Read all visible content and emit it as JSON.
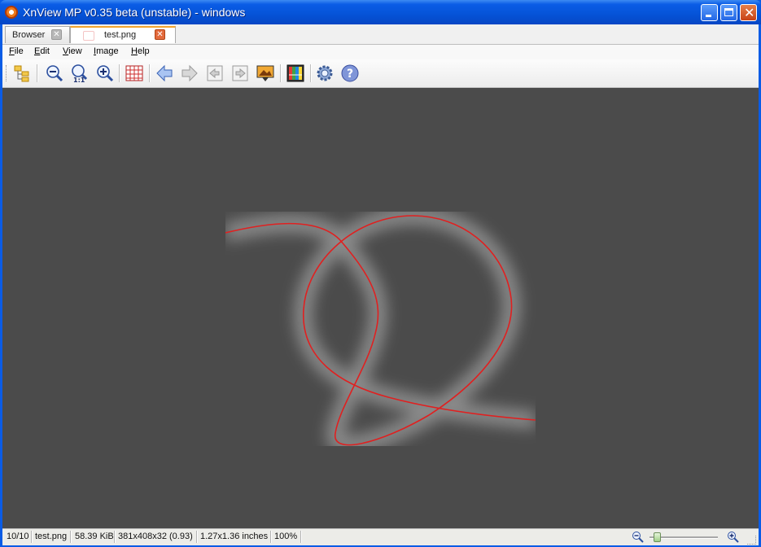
{
  "window": {
    "title": "XnView MP v0.35 beta (unstable) - windows"
  },
  "tabs": [
    {
      "label": "Browser"
    },
    {
      "label": "test.png"
    }
  ],
  "menu": [
    {
      "label": "File",
      "mnemonic": "F",
      "rest": "ile"
    },
    {
      "label": "Edit",
      "mnemonic": "E",
      "rest": "dit"
    },
    {
      "label": "View",
      "mnemonic": "V",
      "rest": "iew"
    },
    {
      "label": "Image",
      "mnemonic": "I",
      "rest": "mage"
    },
    {
      "label": "Help",
      "mnemonic": "H",
      "rest": "elp"
    }
  ],
  "toolbar": {
    "icons": [
      "folder-tree-icon",
      "zoom-out-icon",
      "zoom-actual-icon",
      "zoom-in-icon",
      "grid-icon",
      "arrow-left-icon",
      "arrow-right-icon",
      "first-image-icon",
      "last-image-icon",
      "slideshow-icon",
      "color-adjust-icon",
      "settings-gear-icon",
      "help-icon"
    ],
    "zoom_actual_text": "1:1"
  },
  "viewer": {
    "background": "#4b4b4b",
    "stroke_color": "#e02020"
  },
  "status": {
    "index": "10/10",
    "filename": "test.png",
    "filesize": "58.39 KiB",
    "dimensions": "381x408x32 (0.93)",
    "print_size": "1.27x1.36 inches",
    "zoom": "100%"
  }
}
